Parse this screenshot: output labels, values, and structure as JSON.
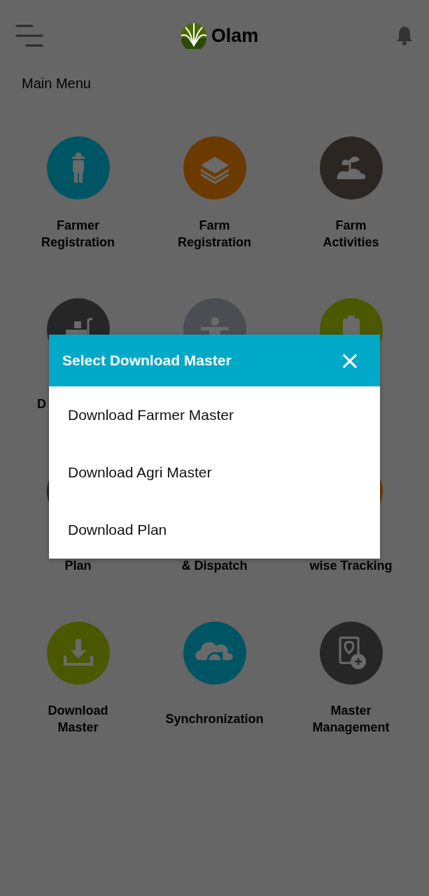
{
  "header": {
    "brand": "Olam"
  },
  "title": "Main Menu",
  "tiles": [
    {
      "label": [
        "Farmer",
        "Registration"
      ],
      "color": "#005565"
    },
    {
      "label": [
        "Farm",
        "Registration"
      ],
      "color": "#6b3a00"
    },
    {
      "label": [
        "Farm",
        "Activities"
      ],
      "color": "#2b2622"
    },
    {
      "label": [
        "D"
      ],
      "kind": "clipped",
      "color": "#262626"
    },
    {
      "color": "#4a4d52"
    },
    {
      "color": "#4b5800"
    },
    {
      "label": [
        "Plan"
      ],
      "kind": "covered",
      "color": "#262626"
    },
    {
      "label": [
        "& Dispatch"
      ],
      "kind": "covered"
    },
    {
      "label": [
        "wise Tracking"
      ],
      "kind": "covered",
      "color": "#6b3a00"
    },
    {
      "label": [
        "Download",
        "Master"
      ],
      "color": "#4b5800"
    },
    {
      "label": [
        "Synchronization"
      ],
      "color": "#005565"
    },
    {
      "label": [
        "Master",
        "Management"
      ],
      "color": "#262626"
    }
  ],
  "dialog": {
    "title": "Select Download Master",
    "close": "×",
    "options": [
      "Download Farmer Master",
      "Download Agri Master",
      "Download Plan"
    ]
  }
}
